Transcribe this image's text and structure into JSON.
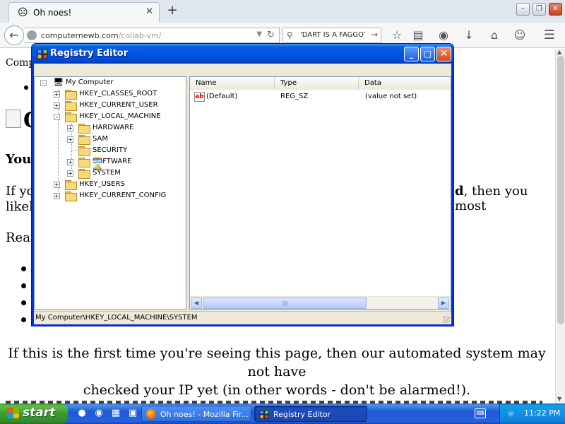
{
  "browser": {
    "tab_title": "Oh noes!",
    "url_domain": "computernewb.com",
    "url_path": "/collab-vm/",
    "search_text": "'DART IS A FAGGOT"
  },
  "page": {
    "line_comp": "Comp",
    "heading_fragment": "O",
    "bold_you": "You",
    "para1_left": "If yo",
    "para1_right_bold": "d",
    "para1_right": ", then you most",
    "para1_line2": "likel",
    "reas": "Reas",
    "first_time_line1": "If this is the first time you're seeing this page, then our automated system may not have",
    "first_time_line2": "checked your IP yet (in other words - don't be alarmed!)."
  },
  "regedit": {
    "title": "Registry Editor",
    "tree": {
      "root": "My Computer",
      "hkcr": "HKEY_CLASSES_ROOT",
      "hkcu": "HKEY_CURRENT_USER",
      "hklm": "HKEY_LOCAL_MACHINE",
      "hardware": "HARDWARE",
      "sam": "SAM",
      "security": "SECURITY",
      "software": "SOFTWARE",
      "system": "SYSTEM",
      "hku": "HKEY_USERS",
      "hkcc": "HKEY_CURRENT_CONFIG"
    },
    "columns": {
      "name": "Name",
      "type": "Type",
      "data": "Data"
    },
    "rows": [
      {
        "name": "(Default)",
        "type": "REG_SZ",
        "data": "(value not set)",
        "icon": "ab"
      }
    ],
    "status": "My Computer\\HKEY_LOCAL_MACHINE\\SYSTEM"
  },
  "taskbar": {
    "start_label": "start",
    "task_firefox": "Oh noes! - Mozilla Fir...",
    "task_regedit": "Registry Editor",
    "clock": "11:22 PM"
  }
}
